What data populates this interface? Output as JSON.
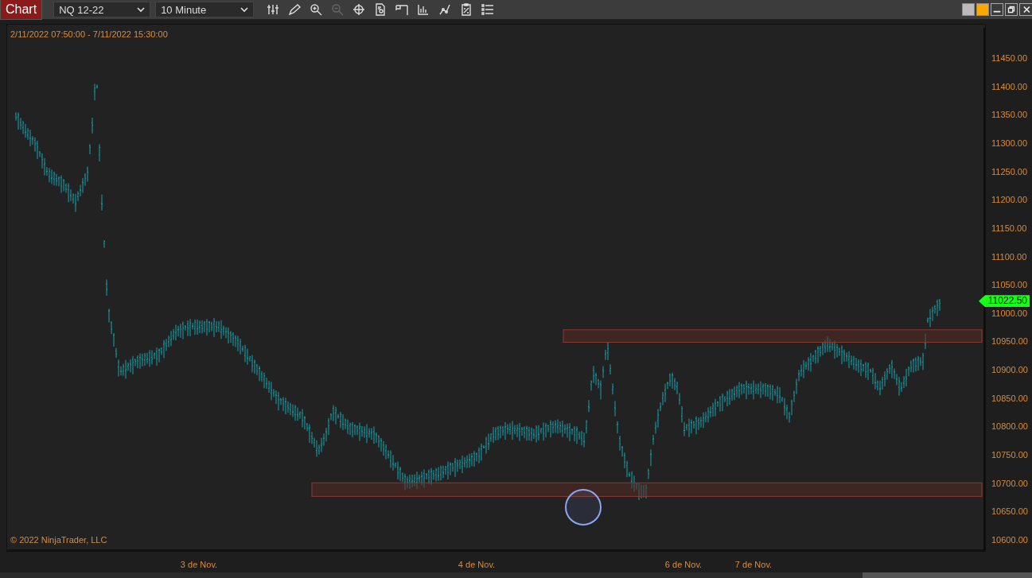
{
  "toolbar": {
    "title": "Chart",
    "instrument": "NQ 12-22",
    "interval": "10 Minute"
  },
  "chart": {
    "date_range": "2/11/2022 07:50:00 - 7/11/2022 15:30:00",
    "copyright": "© 2022 NinjaTrader, LLC",
    "last_price": "11022.50",
    "y_labels": [
      "11450.00",
      "11400.00",
      "11350.00",
      "11300.00",
      "11250.00",
      "11200.00",
      "11150.00",
      "11100.00",
      "11050.00",
      "11000.00",
      "10950.00",
      "10900.00",
      "10850.00",
      "10800.00",
      "10750.00",
      "10700.00",
      "10650.00",
      "10600.00"
    ],
    "x_labels": [
      "3 de Nov.",
      "4 de Nov.",
      "6 de Nov.",
      "7 de Nov."
    ]
  }
}
